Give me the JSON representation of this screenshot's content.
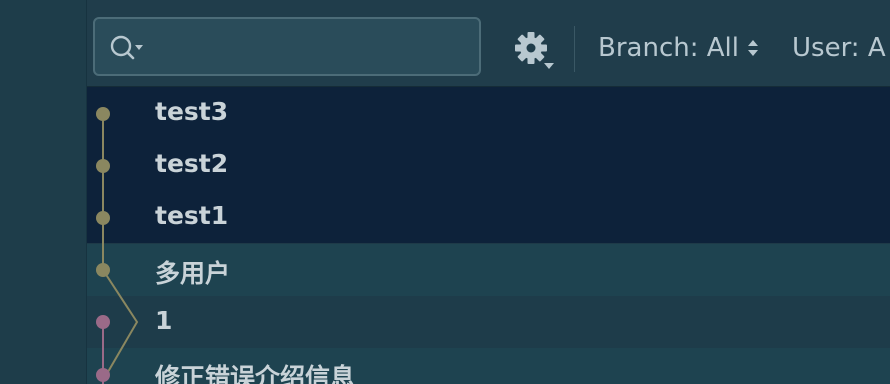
{
  "toolbar": {
    "search": {
      "placeholder": "",
      "value": ""
    },
    "settings_icon": "gear-icon",
    "branch_filter_label": "Branch: All",
    "user_filter_label": "User: A"
  },
  "commits": [
    {
      "message": "test3",
      "selected": true,
      "lane_color": "#8a8760"
    },
    {
      "message": "test2",
      "selected": true,
      "lane_color": "#8a8760"
    },
    {
      "message": "test1",
      "selected": true,
      "lane_color": "#8a8760"
    },
    {
      "message": "多用户",
      "selected": false,
      "lane_color": "#8a8760"
    },
    {
      "message": "1",
      "selected": false,
      "lane_color": "#9a6a88"
    },
    {
      "message": "修正错误介绍信息",
      "selected": false,
      "lane_color": "#9a6a88"
    }
  ],
  "colors": {
    "selected_row": "#0d223a",
    "lane_primary": "#8a8760",
    "lane_secondary": "#9a6a88",
    "text": "#c9d3d8"
  }
}
